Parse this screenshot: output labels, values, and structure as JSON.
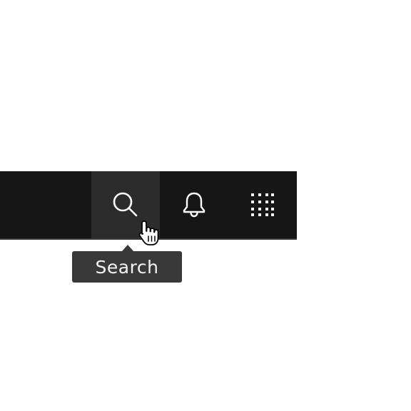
{
  "header": {
    "actions": [
      {
        "id": "search",
        "icon": "search-icon",
        "state": "hover"
      },
      {
        "id": "notifications",
        "icon": "bell-icon"
      },
      {
        "id": "app-switcher",
        "icon": "grid-icon"
      }
    ]
  },
  "tooltip": {
    "text": "Search"
  },
  "colors": {
    "header_bg": "#161616",
    "hover_bg": "#2c2c2c",
    "icon": "#ffffff",
    "tooltip_bg": "#393939",
    "tooltip_text": "#f4f4f4"
  }
}
